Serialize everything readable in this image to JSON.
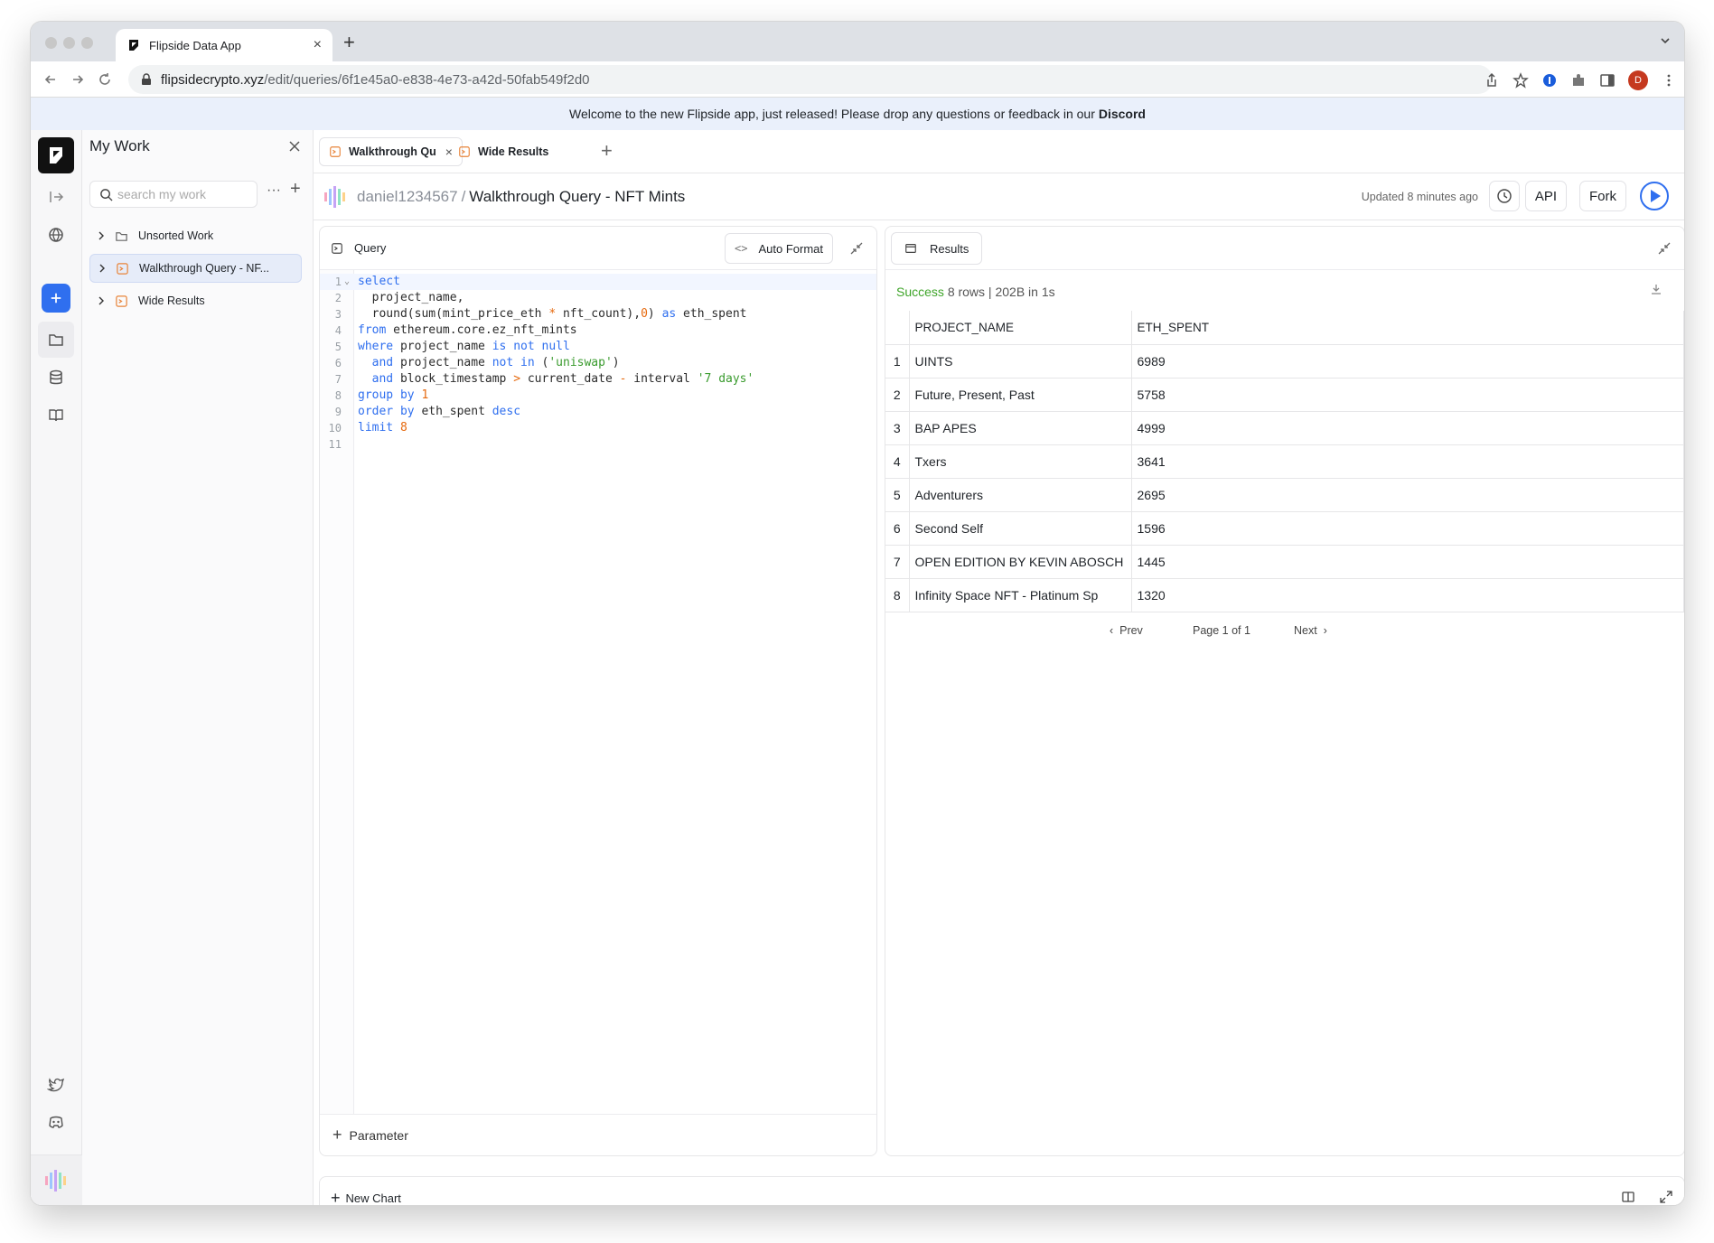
{
  "browser": {
    "tab_title": "Flipside Data App",
    "url_host": "flipsidecrypto.xyz",
    "url_path": "/edit/queries/6f1e45a0-e838-4e73-a42d-50fab549f2d0",
    "profile_initial": "D"
  },
  "banner": {
    "text": "Welcome to the new Flipside app, just released! Please drop any questions or feedback in our",
    "link": "Discord"
  },
  "sidebar": {
    "title": "My Work",
    "search_placeholder": "search my work",
    "items": [
      {
        "label": "Unsorted Work",
        "icon": "folder-icon"
      },
      {
        "label": "Walkthrough Query - NF...",
        "icon": "query-icon",
        "selected": true
      },
      {
        "label": "Wide Results",
        "icon": "query-icon"
      }
    ]
  },
  "tabs": [
    {
      "label": "Walkthrough Qu",
      "active": true
    },
    {
      "label": "Wide Results",
      "active": false
    }
  ],
  "query": {
    "owner": "daniel1234567",
    "name": "Walkthrough Query - NFT Mints",
    "updated": "Updated 8 minutes ago",
    "api_label": "API",
    "fork_label": "Fork",
    "pane_title": "Query",
    "auto_format": "Auto Format",
    "parameter": "Parameter"
  },
  "results": {
    "pane_title": "Results",
    "status": "Success",
    "summary": "8 rows | 202B in 1s",
    "columns": [
      "PROJECT_NAME",
      "ETH_SPENT"
    ],
    "rows": [
      {
        "idx": "1",
        "project_name": "UINTS",
        "eth_spent": "6989"
      },
      {
        "idx": "2",
        "project_name": "Future, Present, Past",
        "eth_spent": "5758"
      },
      {
        "idx": "3",
        "project_name": "BAP APES",
        "eth_spent": "4999"
      },
      {
        "idx": "4",
        "project_name": "Txers",
        "eth_spent": "3641"
      },
      {
        "idx": "5",
        "project_name": "Adventurers",
        "eth_spent": "2695"
      },
      {
        "idx": "6",
        "project_name": "Second Self",
        "eth_spent": "1596"
      },
      {
        "idx": "7",
        "project_name": "OPEN EDITION BY KEVIN ABOSCH",
        "eth_spent": "1445"
      },
      {
        "idx": "8",
        "project_name": "Infinity Space NFT - Platinum Sp",
        "eth_spent": "1320"
      }
    ],
    "prev": "Prev",
    "page": "Page 1 of 1",
    "next": "Next"
  },
  "footer": {
    "new_chart": "New Chart"
  },
  "colors": {
    "accent": "#2f6fef",
    "success": "#3fa52a",
    "keyword": "#2f6fef",
    "string": "#3a9b2e",
    "number": "#e66a0f"
  }
}
